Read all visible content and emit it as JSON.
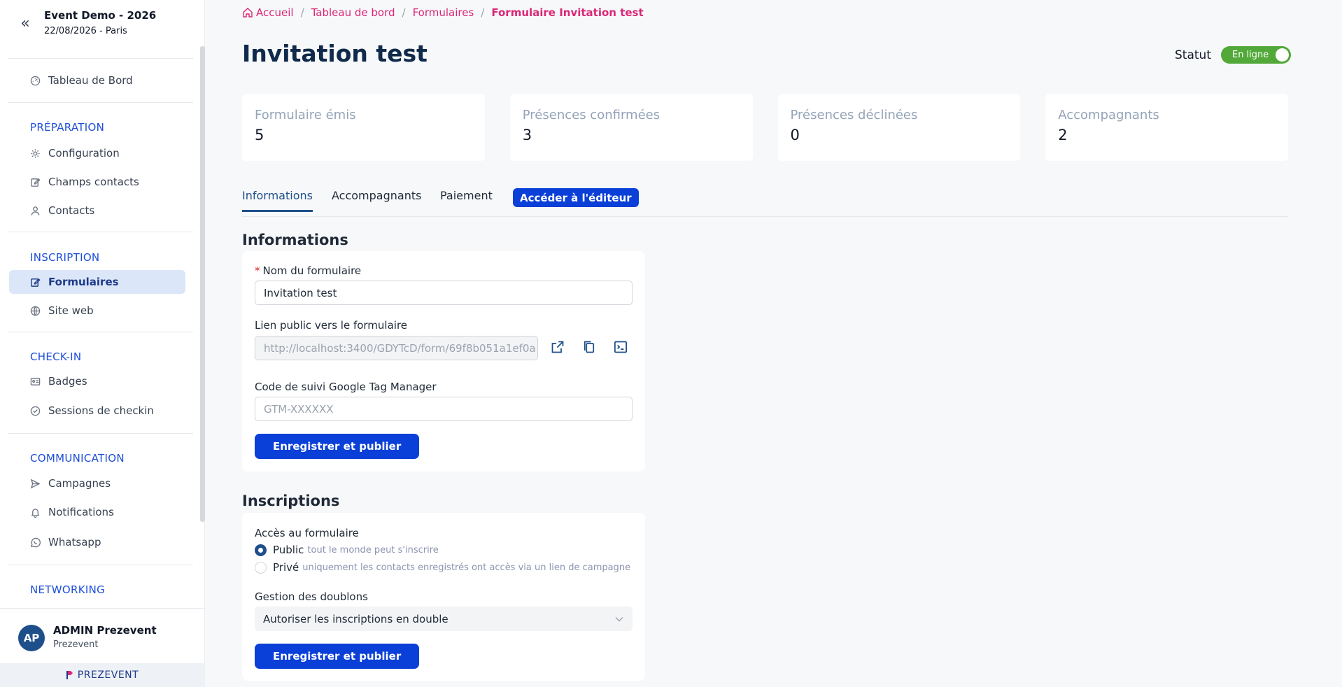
{
  "event": {
    "name": "Event Demo - 2026",
    "date": "22/08/2026 - Paris"
  },
  "sidebar": {
    "dashboard": "Tableau de Bord",
    "sections": {
      "preparation": "PRÉPARATION",
      "inscription": "INSCRIPTION",
      "checkin": "CHECK-IN",
      "communication": "COMMUNICATION",
      "networking": "NETWORKING"
    },
    "items": {
      "configuration": "Configuration",
      "champs_contacts": "Champs contacts",
      "contacts": "Contacts",
      "formulaires": "Formulaires",
      "site_web": "Site web",
      "badges": "Badges",
      "sessions": "Sessions de checkin",
      "campagnes": "Campagnes",
      "notifications": "Notifications",
      "whatsapp": "Whatsapp"
    },
    "active_item": "Formulaires"
  },
  "user": {
    "initials": "AP",
    "name": "ADMIN Prezevent",
    "org": "Prezevent"
  },
  "brand": "PREZEVENT",
  "breadcrumb": {
    "home": "Accueil",
    "dashboard": "Tableau de bord",
    "forms": "Formulaires",
    "current": "Formulaire Invitation test"
  },
  "page": {
    "title": "Invitation test",
    "status_label": "Statut",
    "status_value": "En ligne",
    "status_on": true
  },
  "stats": [
    {
      "label": "Formulaire émis",
      "value": "5"
    },
    {
      "label": "Présences confirmées",
      "value": "3"
    },
    {
      "label": "Présences déclinées",
      "value": "0"
    },
    {
      "label": "Accompagnants",
      "value": "2"
    }
  ],
  "tabs": {
    "informations": "Informations",
    "accompagnants": "Accompagnants",
    "paiement": "Paiement",
    "editor": "Accéder à l'éditeur",
    "active": "Informations"
  },
  "informations": {
    "heading": "Informations",
    "name_label": "Nom du formulaire",
    "name_value": "Invitation test",
    "link_label": "Lien public vers le formulaire",
    "link_value": "http://localhost:3400/GDYTcD/form/69f8b051a1ef0a",
    "gtm_label": "Code de suivi Google Tag Manager",
    "gtm_placeholder": "GTM-XXXXXX",
    "save": "Enregistrer et publier"
  },
  "inscriptions": {
    "heading": "Inscriptions",
    "access_label": "Accès au formulaire",
    "public_label": "Public",
    "public_hint": "tout le monde peut s'inscrire",
    "private_label": "Privé",
    "private_hint": "uniquement les contacts enregistrés ont accès via un lien de campagne",
    "selected": "Public",
    "duplicates_label": "Gestion des doublons",
    "duplicates_value": "Autoriser les inscriptions en double",
    "save": "Enregistrer et publier"
  },
  "colors": {
    "accent": "#0a3fd8",
    "breadcrumb": "#db2777",
    "status_on": "#52a939",
    "navy": "#1e4f8a"
  }
}
